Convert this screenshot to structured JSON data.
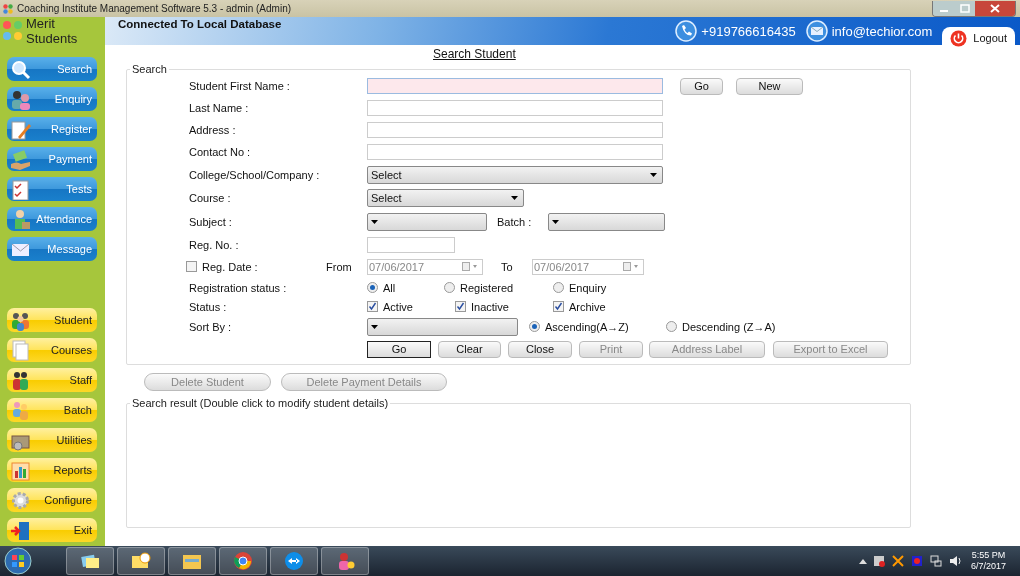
{
  "window": {
    "title": "Coaching Institute Management Software 5.3  -  admin (Admin)"
  },
  "app": {
    "name": "Merit Students"
  },
  "banner": {
    "connection": "Connected To  Local Database",
    "phone": "+919766616435",
    "email": "info@techior.com",
    "logout": "Logout"
  },
  "sidebar": {
    "primary": [
      {
        "label": "Search"
      },
      {
        "label": "Enquiry"
      },
      {
        "label": "Register"
      },
      {
        "label": "Payment"
      },
      {
        "label": "Tests"
      },
      {
        "label": "Attendance"
      },
      {
        "label": "Message"
      }
    ],
    "secondary": [
      {
        "label": "Student"
      },
      {
        "label": "Courses"
      },
      {
        "label": "Staff"
      },
      {
        "label": "Batch"
      },
      {
        "label": "Utilities"
      },
      {
        "label": "Reports"
      },
      {
        "label": "Configure"
      },
      {
        "label": "Exit"
      }
    ]
  },
  "page_title": "Search Student",
  "form": {
    "legend": "Search",
    "rows": [
      {
        "label": "Student First Name :",
        "controls": [
          {
            "kind": "text",
            "highlighted": true
          },
          {
            "kind": "button",
            "label": "Go",
            "disabled": false,
            "focused": false
          },
          {
            "kind": "button",
            "label": "New",
            "disabled": false,
            "focused": false
          }
        ]
      },
      {
        "label": "Last Name :",
        "controls": [
          {
            "kind": "text",
            "highlighted": false
          }
        ]
      },
      {
        "label": "Address :",
        "controls": [
          {
            "kind": "text",
            "highlighted": false
          }
        ]
      },
      {
        "label": "Contact No :",
        "controls": [
          {
            "kind": "text",
            "highlighted": false
          }
        ]
      },
      {
        "label": "College/School/Company :",
        "controls": [
          {
            "kind": "select",
            "value": "Select"
          }
        ]
      },
      {
        "label": "Course :",
        "controls": [
          {
            "kind": "select",
            "value": "Select"
          }
        ]
      },
      {
        "label": "Subject :",
        "controls": [
          {
            "kind": "select"
          },
          {
            "kind": "label",
            "text": "Batch :"
          },
          {
            "kind": "select"
          }
        ]
      },
      {
        "label": "Reg. No. :",
        "controls": [
          {
            "kind": "text",
            "highlighted": false
          }
        ]
      },
      {
        "controls": [
          {
            "kind": "checkbox",
            "label": "Reg. Date :",
            "checked": false
          },
          {
            "kind": "label",
            "text": "From"
          },
          {
            "kind": "date",
            "value": "07/06/2017",
            "disabled": true
          },
          {
            "kind": "label",
            "text": "To"
          },
          {
            "kind": "date",
            "value": "07/06/2017",
            "disabled": true
          }
        ]
      },
      {
        "label": "Registration status :",
        "controls": [
          {
            "kind": "radio",
            "label": "All",
            "selected": true
          },
          {
            "kind": "radio",
            "label": "Registered",
            "selected": false
          },
          {
            "kind": "radio",
            "label": "Enquiry",
            "selected": false
          }
        ]
      },
      {
        "label": "Status :",
        "controls": [
          {
            "kind": "checkbox",
            "label": "Active",
            "checked": true
          },
          {
            "kind": "checkbox",
            "label": "Inactive",
            "checked": true
          },
          {
            "kind": "checkbox",
            "label": "Archive",
            "checked": true
          }
        ]
      },
      {
        "label": "Sort By :",
        "controls": [
          {
            "kind": "select"
          },
          {
            "kind": "radio",
            "label": "Ascending(A→Z)",
            "selected": true
          },
          {
            "kind": "radio",
            "label": "Descending (Z→A)",
            "selected": false
          }
        ]
      },
      {
        "controls": [
          {
            "kind": "button",
            "label": "Go",
            "disabled": false,
            "focused": true
          },
          {
            "kind": "button",
            "label": "Clear",
            "disabled": false,
            "focused": false
          },
          {
            "kind": "button",
            "label": "Close",
            "disabled": false,
            "focused": false
          },
          {
            "kind": "button",
            "label": "Print",
            "disabled": true,
            "focused": false
          },
          {
            "kind": "button",
            "label": "Address Label",
            "disabled": true,
            "focused": false
          },
          {
            "kind": "button",
            "label": "Export to Excel",
            "disabled": true,
            "focused": false
          }
        ]
      }
    ]
  },
  "actions": [
    {
      "label": "Delete Student",
      "disabled": true
    },
    {
      "label": "Delete Payment Details",
      "disabled": true
    }
  ],
  "results": {
    "legend": "Search result (Double click to modify student details)"
  },
  "taskbar": {
    "time": "5:55 PM",
    "date": "6/7/2017"
  }
}
